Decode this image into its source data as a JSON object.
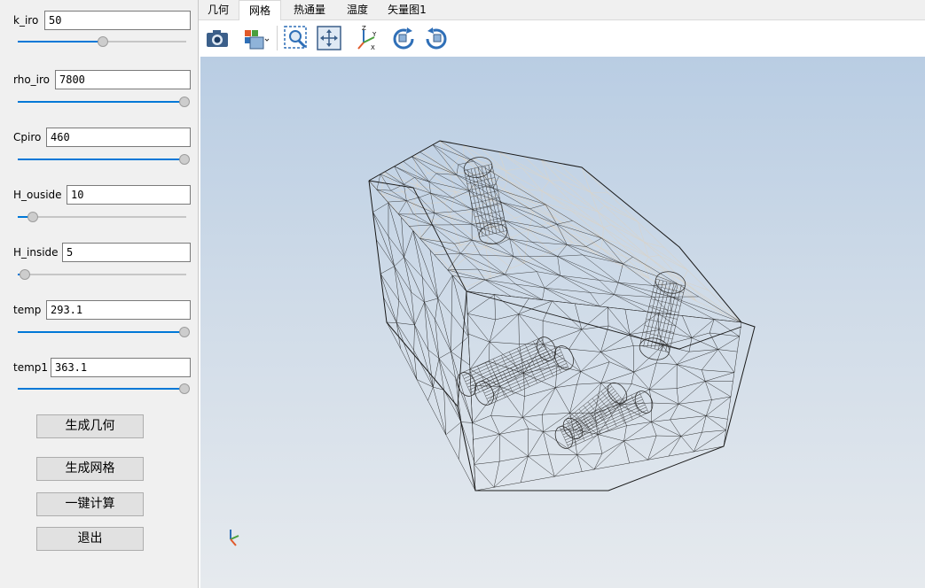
{
  "params": [
    {
      "label": "k_iro",
      "value": "50",
      "fraction": 0.51
    },
    {
      "label": "rho_iro",
      "value": "7800",
      "fraction": 1.0
    },
    {
      "label": "Cpiro",
      "value": "460",
      "fraction": 1.0
    },
    {
      "label": "H_ouside",
      "value": "10",
      "fraction": 0.09
    },
    {
      "label": "H_inside",
      "value": "5",
      "fraction": 0.04
    },
    {
      "label": "temp",
      "value": "293.1",
      "fraction": 1.0
    },
    {
      "label": "temp1",
      "value": "363.1",
      "fraction": 1.0
    }
  ],
  "buttons": {
    "generate_geometry": "生成几何",
    "generate_mesh": "生成网格",
    "compute": "一键计算",
    "exit": "退出"
  },
  "tabs": [
    "几何",
    "网格",
    "热通量",
    "温度",
    "矢量图1"
  ],
  "active_tab": "网格",
  "toolbar_icons": [
    "camera-icon",
    "view-cube-icon",
    "zoom-box-icon",
    "zoom-extents-icon",
    "axis-orientation-icon",
    "rotate-cw-icon",
    "rotate-ccw-icon"
  ],
  "axis_labels": {
    "z": "Z",
    "y": "Y",
    "x": "X"
  },
  "colors": {
    "accent": "#0078d7",
    "viewport_top": "#b9cde3",
    "viewport_bottom": "#e6eaee",
    "mesh_dark": "#1a1a1a",
    "mesh_light": "#d8d4cc"
  }
}
